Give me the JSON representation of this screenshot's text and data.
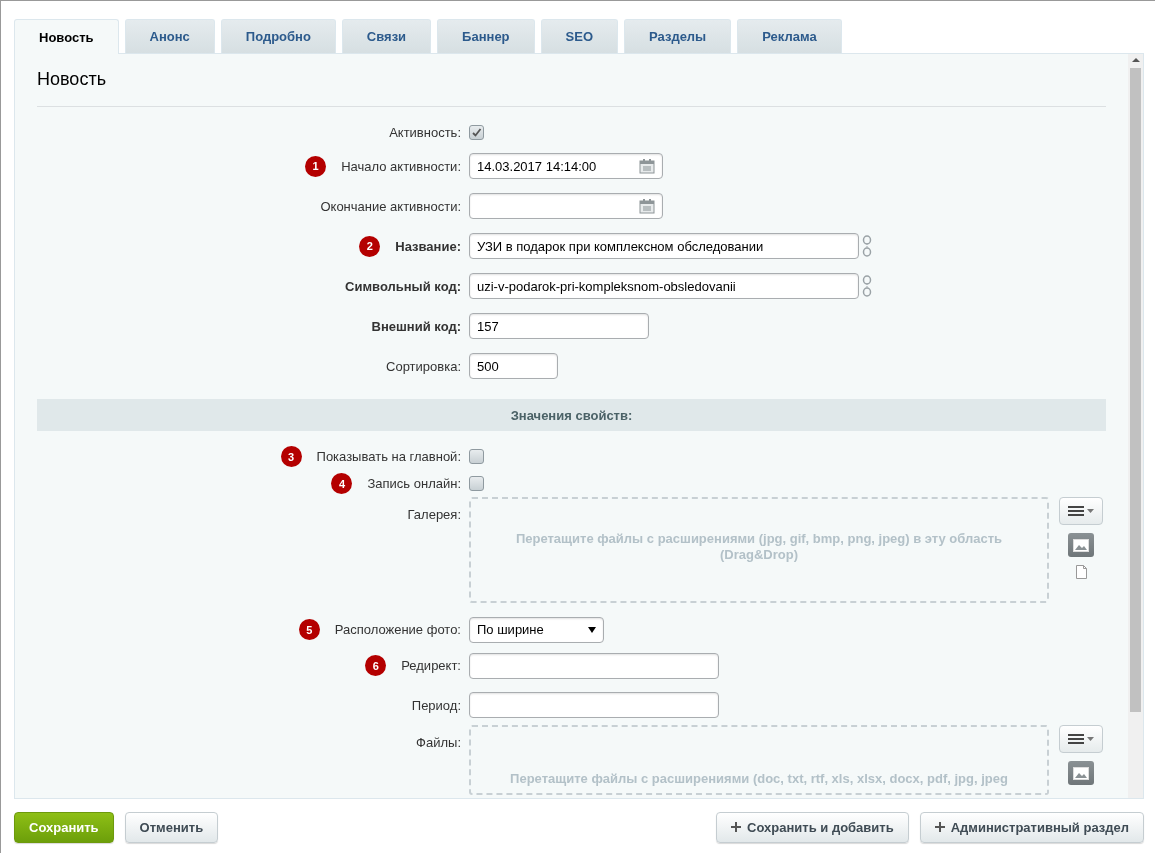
{
  "tabs": [
    {
      "label": "Новость",
      "selected": true
    },
    {
      "label": "Анонс",
      "selected": false
    },
    {
      "label": "Подробно",
      "selected": false
    },
    {
      "label": "Связи",
      "selected": false
    },
    {
      "label": "Баннер",
      "selected": false
    },
    {
      "label": "SEO",
      "selected": false
    },
    {
      "label": "Разделы",
      "selected": false
    },
    {
      "label": "Реклама",
      "selected": false
    }
  ],
  "section_title": "Новость",
  "fields": [
    {
      "kind": "checkbox",
      "label": "Активность:",
      "checked": true,
      "bold": false
    },
    {
      "kind": "date",
      "label": "Начало активности:",
      "value": "14.03.2017 14:14:00",
      "badge": "1",
      "bold": false
    },
    {
      "kind": "date",
      "label": "Окончание активности:",
      "bold": false
    },
    {
      "kind": "text",
      "label": "Название:",
      "value": "УЗИ в подарок при комплексном обследовании",
      "badge": "2",
      "bold": true,
      "translit": true
    },
    {
      "kind": "text",
      "label": "Символьный код:",
      "value": "uzi-v-podarok-pri-kompleksnom-obsledovanii",
      "bold": true,
      "translit": true
    },
    {
      "kind": "text",
      "label": "Внешний код:",
      "value": "157",
      "bold": true
    },
    {
      "kind": "text",
      "label": "Сортировка:",
      "value": "500",
      "bold": false
    },
    {
      "kind": "header",
      "label": "Значения свойств:"
    },
    {
      "kind": "checkbox",
      "label": "Показывать на главной:",
      "checked": false,
      "badge": "3",
      "bold": false
    },
    {
      "kind": "checkbox",
      "label": "Запись онлайн:",
      "checked": false,
      "badge": "4",
      "bold": false
    },
    {
      "kind": "dropzone",
      "label": "Галерея:",
      "hint": "Перетащите файлы с расширениями (jpg, gif, bmp, png, jpeg) в эту область (Drag&Drop)",
      "bold": false
    },
    {
      "kind": "select",
      "label": "Расположение фото:",
      "value": "По ширине",
      "badge": "5",
      "bold": false
    },
    {
      "kind": "text",
      "label": "Редирект:",
      "badge": "6",
      "bold": false
    },
    {
      "kind": "text",
      "label": "Период:",
      "bold": false
    },
    {
      "kind": "dropzone",
      "label": "Файлы:",
      "hint": "Перетащите файлы с расширениями (doc, txt, rtf, xls, xlsx, docx, pdf, jpg, jpeg",
      "bold": false,
      "cut": true
    }
  ],
  "buttons": [
    {
      "label": "Сохранить",
      "kind": "primary"
    },
    {
      "label": "Отменить",
      "kind": "plain"
    },
    {
      "label": "Сохранить и добавить",
      "kind": "add"
    },
    {
      "label": "Административный раздел",
      "kind": "add"
    }
  ]
}
